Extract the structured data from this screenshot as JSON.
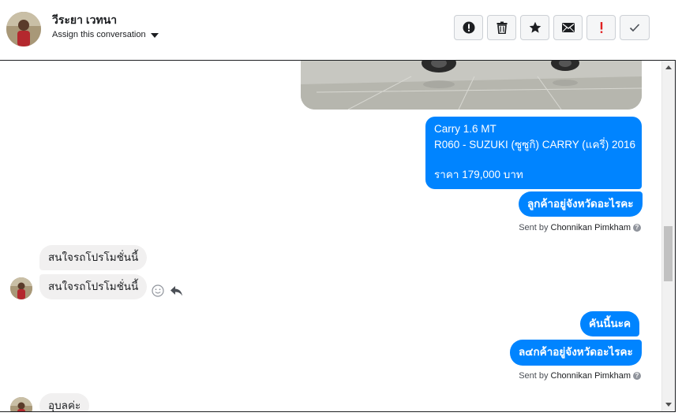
{
  "header": {
    "contact_name": "วีระยา เวทนา",
    "assign_label": "Assign this conversation",
    "actions": [
      {
        "name": "mark-spam-button",
        "icon": "exclamation-circle-icon"
      },
      {
        "name": "delete-button",
        "icon": "trash-icon"
      },
      {
        "name": "star-button",
        "icon": "star-icon"
      },
      {
        "name": "mark-unread-button",
        "icon": "envelope-icon"
      },
      {
        "name": "important-button",
        "icon": "exclamation-icon"
      },
      {
        "name": "done-button",
        "icon": "checkmark-icon"
      }
    ]
  },
  "thread": {
    "car_caption": {
      "line1": "Carry 1.6 MT",
      "line2": "R060 - SUZUKI (ซูซูกิ) CARRY (แครี่) 2016",
      "line3": "ราคา 179,000 บาท"
    },
    "ask_province_1": "ลูกค้าอยู่จังหวัดอะไรคะ",
    "sent_by_1": {
      "prefix": "Sent by",
      "agent": "Chonnikan Pimkham"
    },
    "incoming_1": "สนใจรถโปรโมชั่นนี้",
    "incoming_2": "สนใจรถโปรโมชั่นนี้",
    "reply_this_car": "คันนี้นะค",
    "ask_province_2": "ล๔กค้าอยู่จังหวัดอะไรคะ",
    "sent_by_2": {
      "prefix": "Sent by",
      "agent": "Chonnikan Pimkham"
    },
    "incoming_3": "อุบลค่ะ"
  },
  "colors": {
    "outgoing_bubble": "#0084ff",
    "incoming_bubble": "#f1f0f0",
    "important_icon": "#e02020"
  }
}
